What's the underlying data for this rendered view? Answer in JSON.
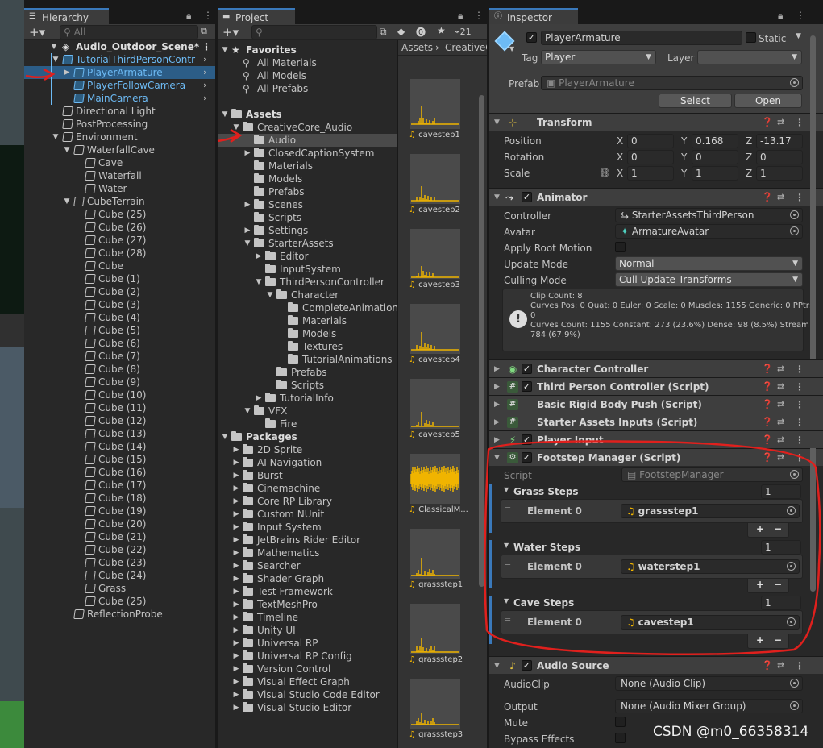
{
  "hierarchy": {
    "tab": "Hierarchy",
    "search_placeholder": "All",
    "scene": "Audio_Outdoor_Scene*",
    "rows": [
      {
        "label": "TutorialThirdPersonContr",
        "depth": 1,
        "prefab": true,
        "arrow": "down"
      },
      {
        "label": "PlayerArmature",
        "depth": 2,
        "prefab": true,
        "arrow": "right",
        "selected": true
      },
      {
        "label": "PlayerFollowCamera",
        "depth": 2,
        "prefab": true,
        "arrow": ""
      },
      {
        "label": "MainCamera",
        "depth": 2,
        "prefab": true,
        "arrow": ""
      },
      {
        "label": "Directional Light",
        "depth": 1,
        "arrow": ""
      },
      {
        "label": "PostProcessing",
        "depth": 1,
        "arrow": ""
      },
      {
        "label": "Environment",
        "depth": 1,
        "arrow": "down"
      },
      {
        "label": "WaterfallCave",
        "depth": 2,
        "arrow": "down"
      },
      {
        "label": "Cave",
        "depth": 3,
        "arrow": ""
      },
      {
        "label": "Waterfall",
        "depth": 3,
        "arrow": ""
      },
      {
        "label": "Water",
        "depth": 3,
        "arrow": ""
      },
      {
        "label": "CubeTerrain",
        "depth": 2,
        "arrow": "down"
      },
      {
        "label": "Cube (25)",
        "depth": 3,
        "arrow": ""
      },
      {
        "label": "Cube (26)",
        "depth": 3,
        "arrow": ""
      },
      {
        "label": "Cube (27)",
        "depth": 3,
        "arrow": ""
      },
      {
        "label": "Cube (28)",
        "depth": 3,
        "arrow": ""
      },
      {
        "label": "Cube",
        "depth": 3,
        "arrow": ""
      },
      {
        "label": "Cube (1)",
        "depth": 3,
        "arrow": ""
      },
      {
        "label": "Cube (2)",
        "depth": 3,
        "arrow": ""
      },
      {
        "label": "Cube (3)",
        "depth": 3,
        "arrow": ""
      },
      {
        "label": "Cube (4)",
        "depth": 3,
        "arrow": ""
      },
      {
        "label": "Cube (5)",
        "depth": 3,
        "arrow": ""
      },
      {
        "label": "Cube (6)",
        "depth": 3,
        "arrow": ""
      },
      {
        "label": "Cube (7)",
        "depth": 3,
        "arrow": ""
      },
      {
        "label": "Cube (8)",
        "depth": 3,
        "arrow": ""
      },
      {
        "label": "Cube (9)",
        "depth": 3,
        "arrow": ""
      },
      {
        "label": "Cube (10)",
        "depth": 3,
        "arrow": ""
      },
      {
        "label": "Cube (11)",
        "depth": 3,
        "arrow": ""
      },
      {
        "label": "Cube (12)",
        "depth": 3,
        "arrow": ""
      },
      {
        "label": "Cube (13)",
        "depth": 3,
        "arrow": ""
      },
      {
        "label": "Cube (14)",
        "depth": 3,
        "arrow": ""
      },
      {
        "label": "Cube (15)",
        "depth": 3,
        "arrow": ""
      },
      {
        "label": "Cube (16)",
        "depth": 3,
        "arrow": ""
      },
      {
        "label": "Cube (17)",
        "depth": 3,
        "arrow": ""
      },
      {
        "label": "Cube (18)",
        "depth": 3,
        "arrow": ""
      },
      {
        "label": "Cube (19)",
        "depth": 3,
        "arrow": ""
      },
      {
        "label": "Cube (20)",
        "depth": 3,
        "arrow": ""
      },
      {
        "label": "Cube (21)",
        "depth": 3,
        "arrow": ""
      },
      {
        "label": "Cube (22)",
        "depth": 3,
        "arrow": ""
      },
      {
        "label": "Cube (23)",
        "depth": 3,
        "arrow": ""
      },
      {
        "label": "Cube (24)",
        "depth": 3,
        "arrow": ""
      },
      {
        "label": "Grass",
        "depth": 3,
        "arrow": ""
      },
      {
        "label": "Cube (25)",
        "depth": 3,
        "arrow": ""
      },
      {
        "label": "ReflectionProbe",
        "depth": 2,
        "arrow": ""
      }
    ]
  },
  "project": {
    "tab": "Project",
    "asset_count": "21",
    "breadcrumb": [
      "Assets",
      "CreativeC"
    ],
    "tree": [
      {
        "label": "Favorites",
        "depth": 0,
        "kind": "star",
        "arrow": "down",
        "bold": true
      },
      {
        "label": "All Materials",
        "depth": 1,
        "kind": "search",
        "arrow": ""
      },
      {
        "label": "All Models",
        "depth": 1,
        "kind": "search",
        "arrow": ""
      },
      {
        "label": "All Prefabs",
        "depth": 1,
        "kind": "search",
        "arrow": ""
      },
      {
        "label": "",
        "depth": 0,
        "kind": "gap",
        "arrow": ""
      },
      {
        "label": "Assets",
        "depth": 0,
        "kind": "folder",
        "arrow": "down",
        "bold": true
      },
      {
        "label": "CreativeCore_Audio",
        "depth": 1,
        "kind": "folder",
        "arrow": "down"
      },
      {
        "label": "Audio",
        "depth": 2,
        "kind": "folder",
        "arrow": "",
        "selected": true
      },
      {
        "label": "ClosedCaptionSystem",
        "depth": 2,
        "kind": "folder",
        "arrow": "right"
      },
      {
        "label": "Materials",
        "depth": 2,
        "kind": "folder",
        "arrow": ""
      },
      {
        "label": "Models",
        "depth": 2,
        "kind": "folder",
        "arrow": ""
      },
      {
        "label": "Prefabs",
        "depth": 2,
        "kind": "folder",
        "arrow": ""
      },
      {
        "label": "Scenes",
        "depth": 2,
        "kind": "folder",
        "arrow": "right"
      },
      {
        "label": "Scripts",
        "depth": 2,
        "kind": "folder",
        "arrow": ""
      },
      {
        "label": "Settings",
        "depth": 2,
        "kind": "folder",
        "arrow": "right"
      },
      {
        "label": "StarterAssets",
        "depth": 2,
        "kind": "folder",
        "arrow": "down"
      },
      {
        "label": "Editor",
        "depth": 3,
        "kind": "folder",
        "arrow": "right"
      },
      {
        "label": "InputSystem",
        "depth": 3,
        "kind": "folder",
        "arrow": ""
      },
      {
        "label": "ThirdPersonController",
        "depth": 3,
        "kind": "folder",
        "arrow": "down"
      },
      {
        "label": "Character",
        "depth": 4,
        "kind": "folder",
        "arrow": "down"
      },
      {
        "label": "CompleteAnimations",
        "depth": 5,
        "kind": "folder",
        "arrow": ""
      },
      {
        "label": "Materials",
        "depth": 5,
        "kind": "folder",
        "arrow": ""
      },
      {
        "label": "Models",
        "depth": 5,
        "kind": "folder",
        "arrow": ""
      },
      {
        "label": "Textures",
        "depth": 5,
        "kind": "folder",
        "arrow": ""
      },
      {
        "label": "TutorialAnimations",
        "depth": 5,
        "kind": "folder",
        "arrow": ""
      },
      {
        "label": "Prefabs",
        "depth": 4,
        "kind": "folder",
        "arrow": ""
      },
      {
        "label": "Scripts",
        "depth": 4,
        "kind": "folder",
        "arrow": ""
      },
      {
        "label": "TutorialInfo",
        "depth": 3,
        "kind": "folder",
        "arrow": "right"
      },
      {
        "label": "VFX",
        "depth": 2,
        "kind": "folder",
        "arrow": "down"
      },
      {
        "label": "Fire",
        "depth": 3,
        "kind": "folder",
        "arrow": ""
      },
      {
        "label": "Packages",
        "depth": 0,
        "kind": "folder",
        "arrow": "down",
        "bold": true
      },
      {
        "label": "2D Sprite",
        "depth": 1,
        "kind": "folder",
        "arrow": "right"
      },
      {
        "label": "AI Navigation",
        "depth": 1,
        "kind": "folder",
        "arrow": "right"
      },
      {
        "label": "Burst",
        "depth": 1,
        "kind": "folder",
        "arrow": "right"
      },
      {
        "label": "Cinemachine",
        "depth": 1,
        "kind": "folder",
        "arrow": "right"
      },
      {
        "label": "Core RP Library",
        "depth": 1,
        "kind": "folder",
        "arrow": "right"
      },
      {
        "label": "Custom NUnit",
        "depth": 1,
        "kind": "folder",
        "arrow": "right"
      },
      {
        "label": "Input System",
        "depth": 1,
        "kind": "folder",
        "arrow": "right"
      },
      {
        "label": "JetBrains Rider Editor",
        "depth": 1,
        "kind": "folder",
        "arrow": "right"
      },
      {
        "label": "Mathematics",
        "depth": 1,
        "kind": "folder",
        "arrow": "right"
      },
      {
        "label": "Searcher",
        "depth": 1,
        "kind": "folder",
        "arrow": "right"
      },
      {
        "label": "Shader Graph",
        "depth": 1,
        "kind": "folder",
        "arrow": "right"
      },
      {
        "label": "Test Framework",
        "depth": 1,
        "kind": "folder",
        "arrow": "right"
      },
      {
        "label": "TextMeshPro",
        "depth": 1,
        "kind": "folder",
        "arrow": "right"
      },
      {
        "label": "Timeline",
        "depth": 1,
        "kind": "folder",
        "arrow": "right"
      },
      {
        "label": "Unity UI",
        "depth": 1,
        "kind": "folder",
        "arrow": "right"
      },
      {
        "label": "Universal RP",
        "depth": 1,
        "kind": "folder",
        "arrow": "right"
      },
      {
        "label": "Universal RP Config",
        "depth": 1,
        "kind": "folder",
        "arrow": "right"
      },
      {
        "label": "Version Control",
        "depth": 1,
        "kind": "folder",
        "arrow": "right"
      },
      {
        "label": "Visual Effect Graph",
        "depth": 1,
        "kind": "folder",
        "arrow": "right"
      },
      {
        "label": "Visual Studio Code Editor",
        "depth": 1,
        "kind": "folder",
        "arrow": "right"
      },
      {
        "label": "Visual Studio Editor",
        "depth": 1,
        "kind": "folder",
        "arrow": "right"
      }
    ],
    "assets": [
      "cavestep1",
      "cavestep2",
      "cavestep3",
      "cavestep4",
      "cavestep5",
      "ClassicalM...",
      "grassstep1",
      "grassstep2",
      "grassstep3"
    ]
  },
  "inspector": {
    "tab": "Inspector",
    "name": "PlayerArmature",
    "static_label": "Static",
    "tag_label": "Tag",
    "tag_value": "Player",
    "layer_label": "Layer",
    "layer_value": "",
    "prefab_label": "Prefab",
    "prefab_value": "PlayerArmature",
    "select_label": "Select",
    "open_label": "Open",
    "transform": {
      "title": "Transform",
      "position_label": "Position",
      "rotation_label": "Rotation",
      "scale_label": "Scale",
      "x": "X",
      "y": "Y",
      "z": "Z",
      "position": [
        "0",
        "0.168",
        "-13.17"
      ],
      "rotation": [
        "0",
        "0",
        "0"
      ],
      "scale": [
        "1",
        "1",
        "1"
      ]
    },
    "animator": {
      "title": "Animator",
      "controller_label": "Controller",
      "controller_value": "StarterAssetsThirdPerson",
      "avatar_label": "Avatar",
      "avatar_value": "ArmatureAvatar",
      "root_motion_label": "Apply Root Motion",
      "update_label": "Update Mode",
      "update_value": "Normal",
      "culling_label": "Culling Mode",
      "culling_value": "Cull Update Transforms",
      "info": [
        "Clip Count: 8",
        "Curves Pos: 0 Quat: 0 Euler: 0 Scale: 0 Muscles: 1155 Generic: 0 PPtr:",
        "0",
        "Curves Count: 1155 Constant: 273 (23.6%) Dense: 98 (8.5%) Stream:",
        "784 (67.9%)"
      ]
    },
    "components": [
      "Character Controller",
      "Third Person Controller (Script)",
      "Basic Rigid Body Push (Script)",
      "Starter Assets Inputs (Script)",
      "Player Input"
    ],
    "footstep": {
      "title": "Footstep Manager (Script)",
      "script_label": "Script",
      "script_value": "FootstepManager",
      "element_label": "Element 0",
      "lists": [
        {
          "label": "Grass Steps",
          "count": "1",
          "clip": "grassstep1"
        },
        {
          "label": "Water Steps",
          "count": "1",
          "clip": "waterstep1"
        },
        {
          "label": "Cave Steps",
          "count": "1",
          "clip": "cavestep1"
        }
      ]
    },
    "audio_source": {
      "title": "Audio Source",
      "clip_label": "AudioClip",
      "clip_value": "None (Audio Clip)",
      "output_label": "Output",
      "output_value": "None (Audio Mixer Group)",
      "mute_label": "Mute",
      "bypass_label": "Bypass Effects"
    }
  },
  "watermark": "CSDN @m0_66358314",
  "colors": {
    "accent": "#3a79bb",
    "selection": "#2c5d87",
    "annotation": "#e0201d",
    "prefab": "#6dbbf5"
  }
}
